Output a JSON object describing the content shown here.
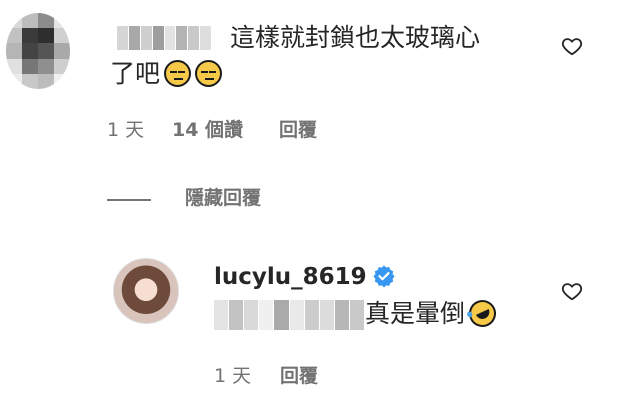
{
  "comment": {
    "text_line1": "這樣就封鎖也太玻璃心",
    "text_line2": "了吧",
    "time": "1 天",
    "likes": "14 個讚",
    "reply_label": "回覆"
  },
  "replies": {
    "hide_label": "隱藏回覆"
  },
  "reply": {
    "username": "lucylu_8619",
    "text": "真是暈倒",
    "time": "1 天",
    "reply_label": "回覆"
  },
  "colors": {
    "text": "#262626",
    "meta": "#737373",
    "verified": "#3897f0"
  },
  "icons": {
    "like": "heart-outline-icon",
    "verified": "verified-badge-icon",
    "emoji1": "unamused-face-emoji",
    "emoji2": "rolling-on-floor-laughing-emoji"
  }
}
